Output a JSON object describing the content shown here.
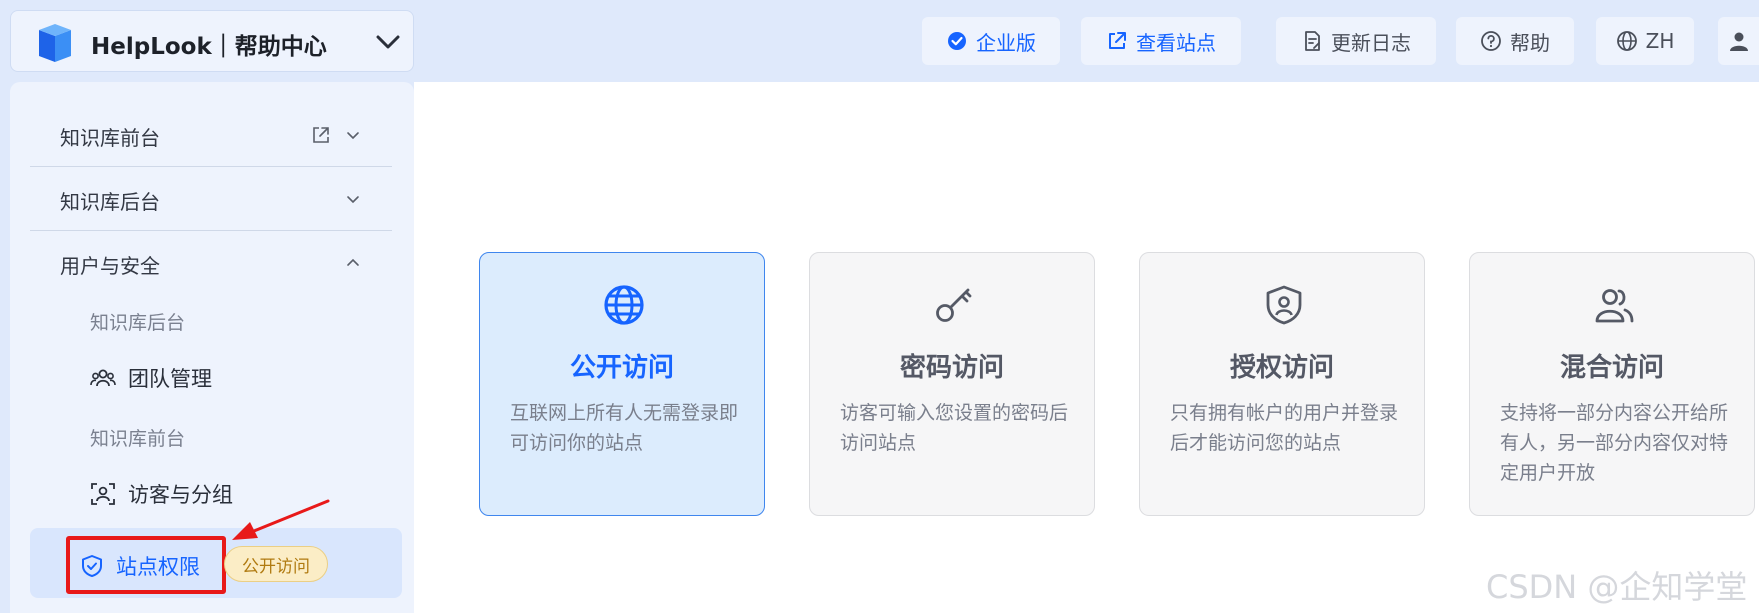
{
  "brand": {
    "name": "HelpLook｜帮助中心"
  },
  "topbar": {
    "enterprise": "企业版",
    "view_site": "查看站点",
    "changelog": "更新日志",
    "help": "帮助",
    "language": "ZH"
  },
  "sidebar": {
    "groups": [
      {
        "label": "知识库前台"
      },
      {
        "label": "知识库后台"
      },
      {
        "label": "用户与安全"
      }
    ],
    "sub_items": {
      "kb_backend": "知识库后台",
      "team": "团队管理",
      "kb_frontend": "知识库前台",
      "visitors": "访客与分组",
      "site_permission": "站点权限",
      "site_permission_badge": "公开访问"
    }
  },
  "access_cards": [
    {
      "title": "公开访问",
      "desc": "互联网上所有人无需登录即可访问你的站点",
      "selected": true,
      "icon": "globe-icon"
    },
    {
      "title": "密码访问",
      "desc": "访客可输入您设置的密码后访问站点",
      "selected": false,
      "icon": "key-icon"
    },
    {
      "title": "授权访问",
      "desc": "只有拥有帐户的用户并登录后才能访问您的站点",
      "selected": false,
      "icon": "shield-user-icon"
    },
    {
      "title": "混合访问",
      "desc": "支持将一部分内容公开给所有人，另一部分内容仅对特定用户开放",
      "selected": false,
      "icon": "users-icon"
    }
  ],
  "watermark": "CSDN @企知学堂",
  "colors": {
    "accent": "#1664ff",
    "highlight": "#e81919",
    "badge_bg": "#fbedc6"
  }
}
